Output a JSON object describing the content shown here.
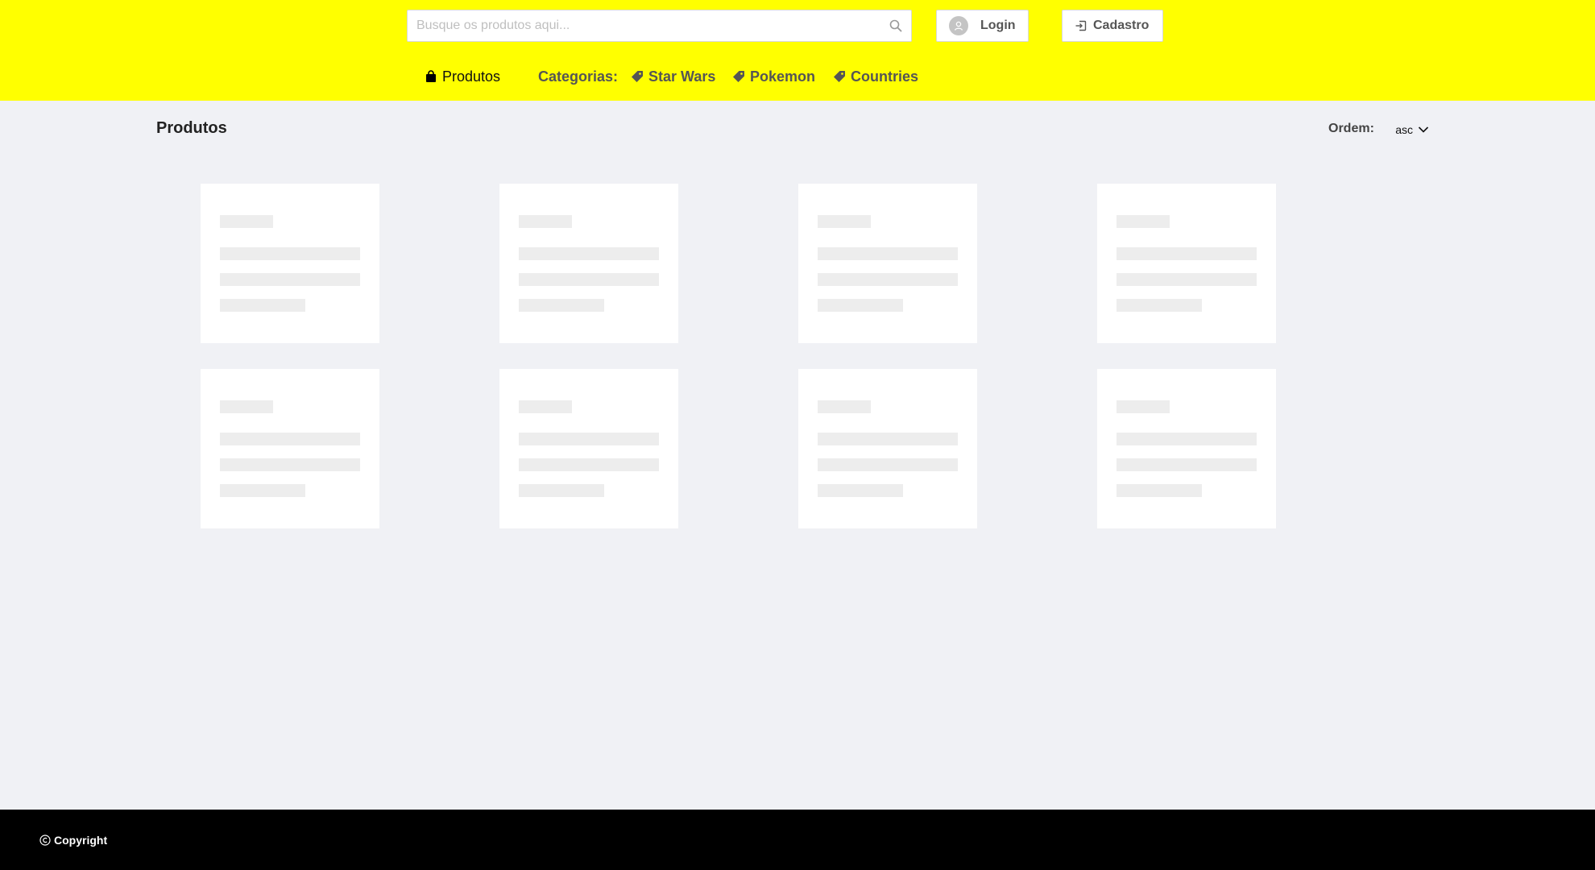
{
  "search": {
    "placeholder": "Busque os produtos aqui...",
    "icon": "search-icon"
  },
  "header": {
    "login_label": "Login",
    "cadastro_label": "Cadastro",
    "background_color": "#ffff00"
  },
  "nav": {
    "produtos_label": "Produtos",
    "categorias_label": "Categorias:",
    "categories": [
      "Star Wars",
      "Pokemon",
      "Countries"
    ]
  },
  "main": {
    "title": "Produtos",
    "order_label": "Ordem:",
    "order_value": "asc",
    "loading_cards": 8
  },
  "footer": {
    "copyright_label": "Copyright",
    "background_color": "#000000"
  }
}
